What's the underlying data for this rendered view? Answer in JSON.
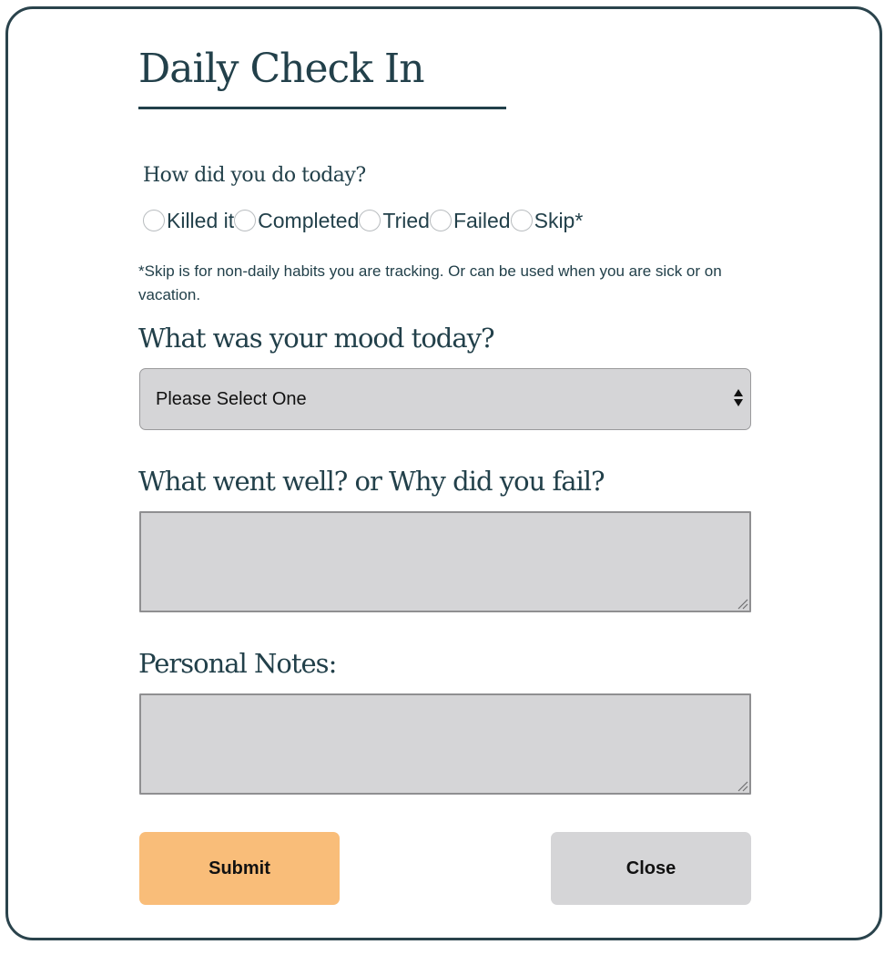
{
  "form": {
    "title": "Daily Check In",
    "status_question": "How did you do today?",
    "status_options": [
      "Killed it",
      "Completed",
      "Tried",
      "Failed",
      "Skip*"
    ],
    "skip_note": "*Skip is for non-daily habits you are tracking. Or can be used when you are sick or on vacation.",
    "mood_question": "What was your mood today?",
    "mood_select": {
      "selected": "Please Select One"
    },
    "reflection_question": "What went well? or Why did you fail?",
    "reflection_value": "",
    "notes_label": "Personal Notes:",
    "notes_value": "",
    "submit_label": "Submit",
    "close_label": "Close"
  },
  "colors": {
    "text": "#22404a",
    "border": "#2a434c",
    "field_bg": "#d5d5d7",
    "submit_bg": "#f9bd79",
    "close_bg": "#d5d5d7"
  }
}
